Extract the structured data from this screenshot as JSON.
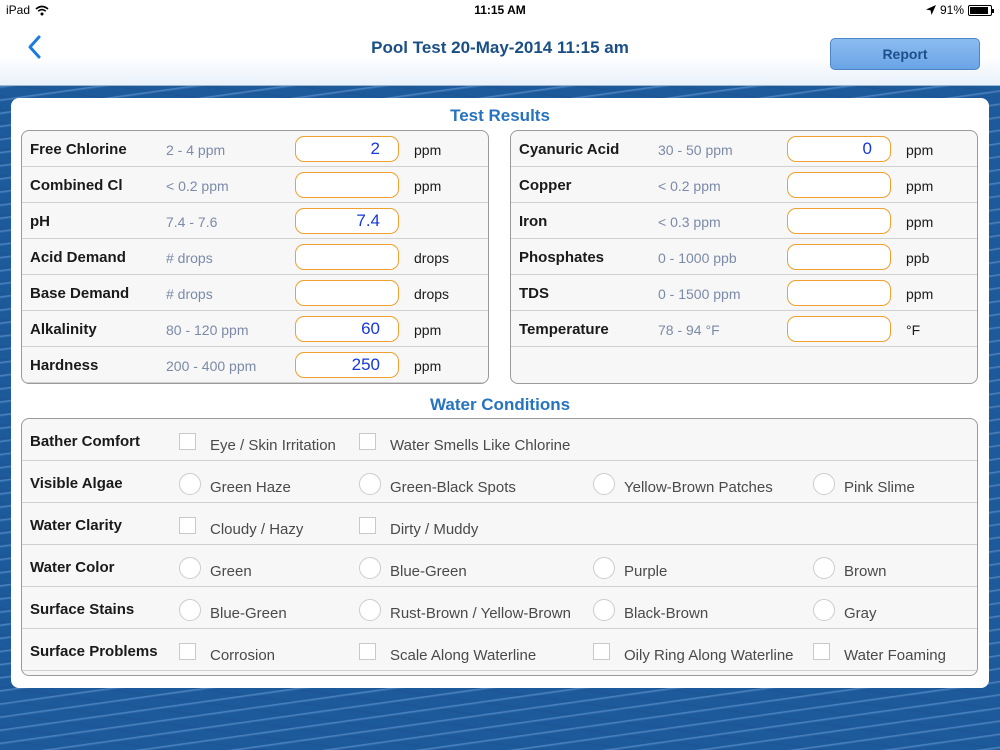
{
  "status": {
    "device": "iPad",
    "time": "11:15 AM",
    "battery": "91%",
    "battery_level": 0.91
  },
  "nav": {
    "back_label": "‹",
    "title": "Pool Test 20-May-2014 11:15 am",
    "report_label": "Report"
  },
  "test_results": {
    "title": "Test Results",
    "left": [
      {
        "label": "Free Chlorine",
        "range": "2 - 4 ppm",
        "value": "2",
        "unit": "ppm"
      },
      {
        "label": "Combined Cl",
        "range": "< 0.2 ppm",
        "value": "",
        "unit": "ppm"
      },
      {
        "label": "pH",
        "range": "7.4 - 7.6",
        "value": "7.4",
        "unit": ""
      },
      {
        "label": "Acid Demand",
        "range": "# drops",
        "value": "",
        "unit": "drops"
      },
      {
        "label": "Base Demand",
        "range": "# drops",
        "value": "",
        "unit": "drops"
      },
      {
        "label": "Alkalinity",
        "range": "80 - 120 ppm",
        "value": "60",
        "unit": "ppm"
      },
      {
        "label": "Hardness",
        "range": "200 - 400 ppm",
        "value": "250",
        "unit": "ppm"
      }
    ],
    "right": [
      {
        "label": "Cyanuric Acid",
        "range": "30 - 50 ppm",
        "value": "0",
        "unit": "ppm"
      },
      {
        "label": "Copper",
        "range": "< 0.2 ppm",
        "value": "",
        "unit": "ppm"
      },
      {
        "label": "Iron",
        "range": "< 0.3 ppm",
        "value": "",
        "unit": "ppm"
      },
      {
        "label": "Phosphates",
        "range": "0 - 1000 ppb",
        "value": "",
        "unit": "ppb"
      },
      {
        "label": "TDS",
        "range": "0 - 1500 ppm",
        "value": "",
        "unit": "ppm"
      },
      {
        "label": "Temperature",
        "range": "78 - 94 °F",
        "value": "",
        "unit": "°F"
      }
    ]
  },
  "water_conditions": {
    "title": "Water Conditions",
    "rows": [
      {
        "label": "Bather Comfort",
        "control": "checkbox",
        "options": [
          "Eye / Skin Irritation",
          "Water Smells Like Chlorine"
        ]
      },
      {
        "label": "Visible Algae",
        "control": "radio",
        "options": [
          "Green Haze",
          "Green-Black Spots",
          "Yellow-Brown Patches",
          "Pink Slime"
        ]
      },
      {
        "label": "Water Clarity",
        "control": "checkbox",
        "options": [
          "Cloudy / Hazy",
          "Dirty / Muddy"
        ]
      },
      {
        "label": "Water Color",
        "control": "radio",
        "options": [
          "Green",
          "Blue-Green",
          "Purple",
          "Brown"
        ]
      },
      {
        "label": "Surface Stains",
        "control": "radio",
        "options": [
          "Blue-Green",
          "Rust-Brown / Yellow-Brown",
          "Black-Brown",
          "Gray"
        ]
      },
      {
        "label": "Surface Problems",
        "control": "checkbox",
        "options": [
          "Corrosion",
          "Scale Along Waterline",
          "Oily Ring Along Waterline",
          "Water Foaming"
        ]
      }
    ]
  }
}
